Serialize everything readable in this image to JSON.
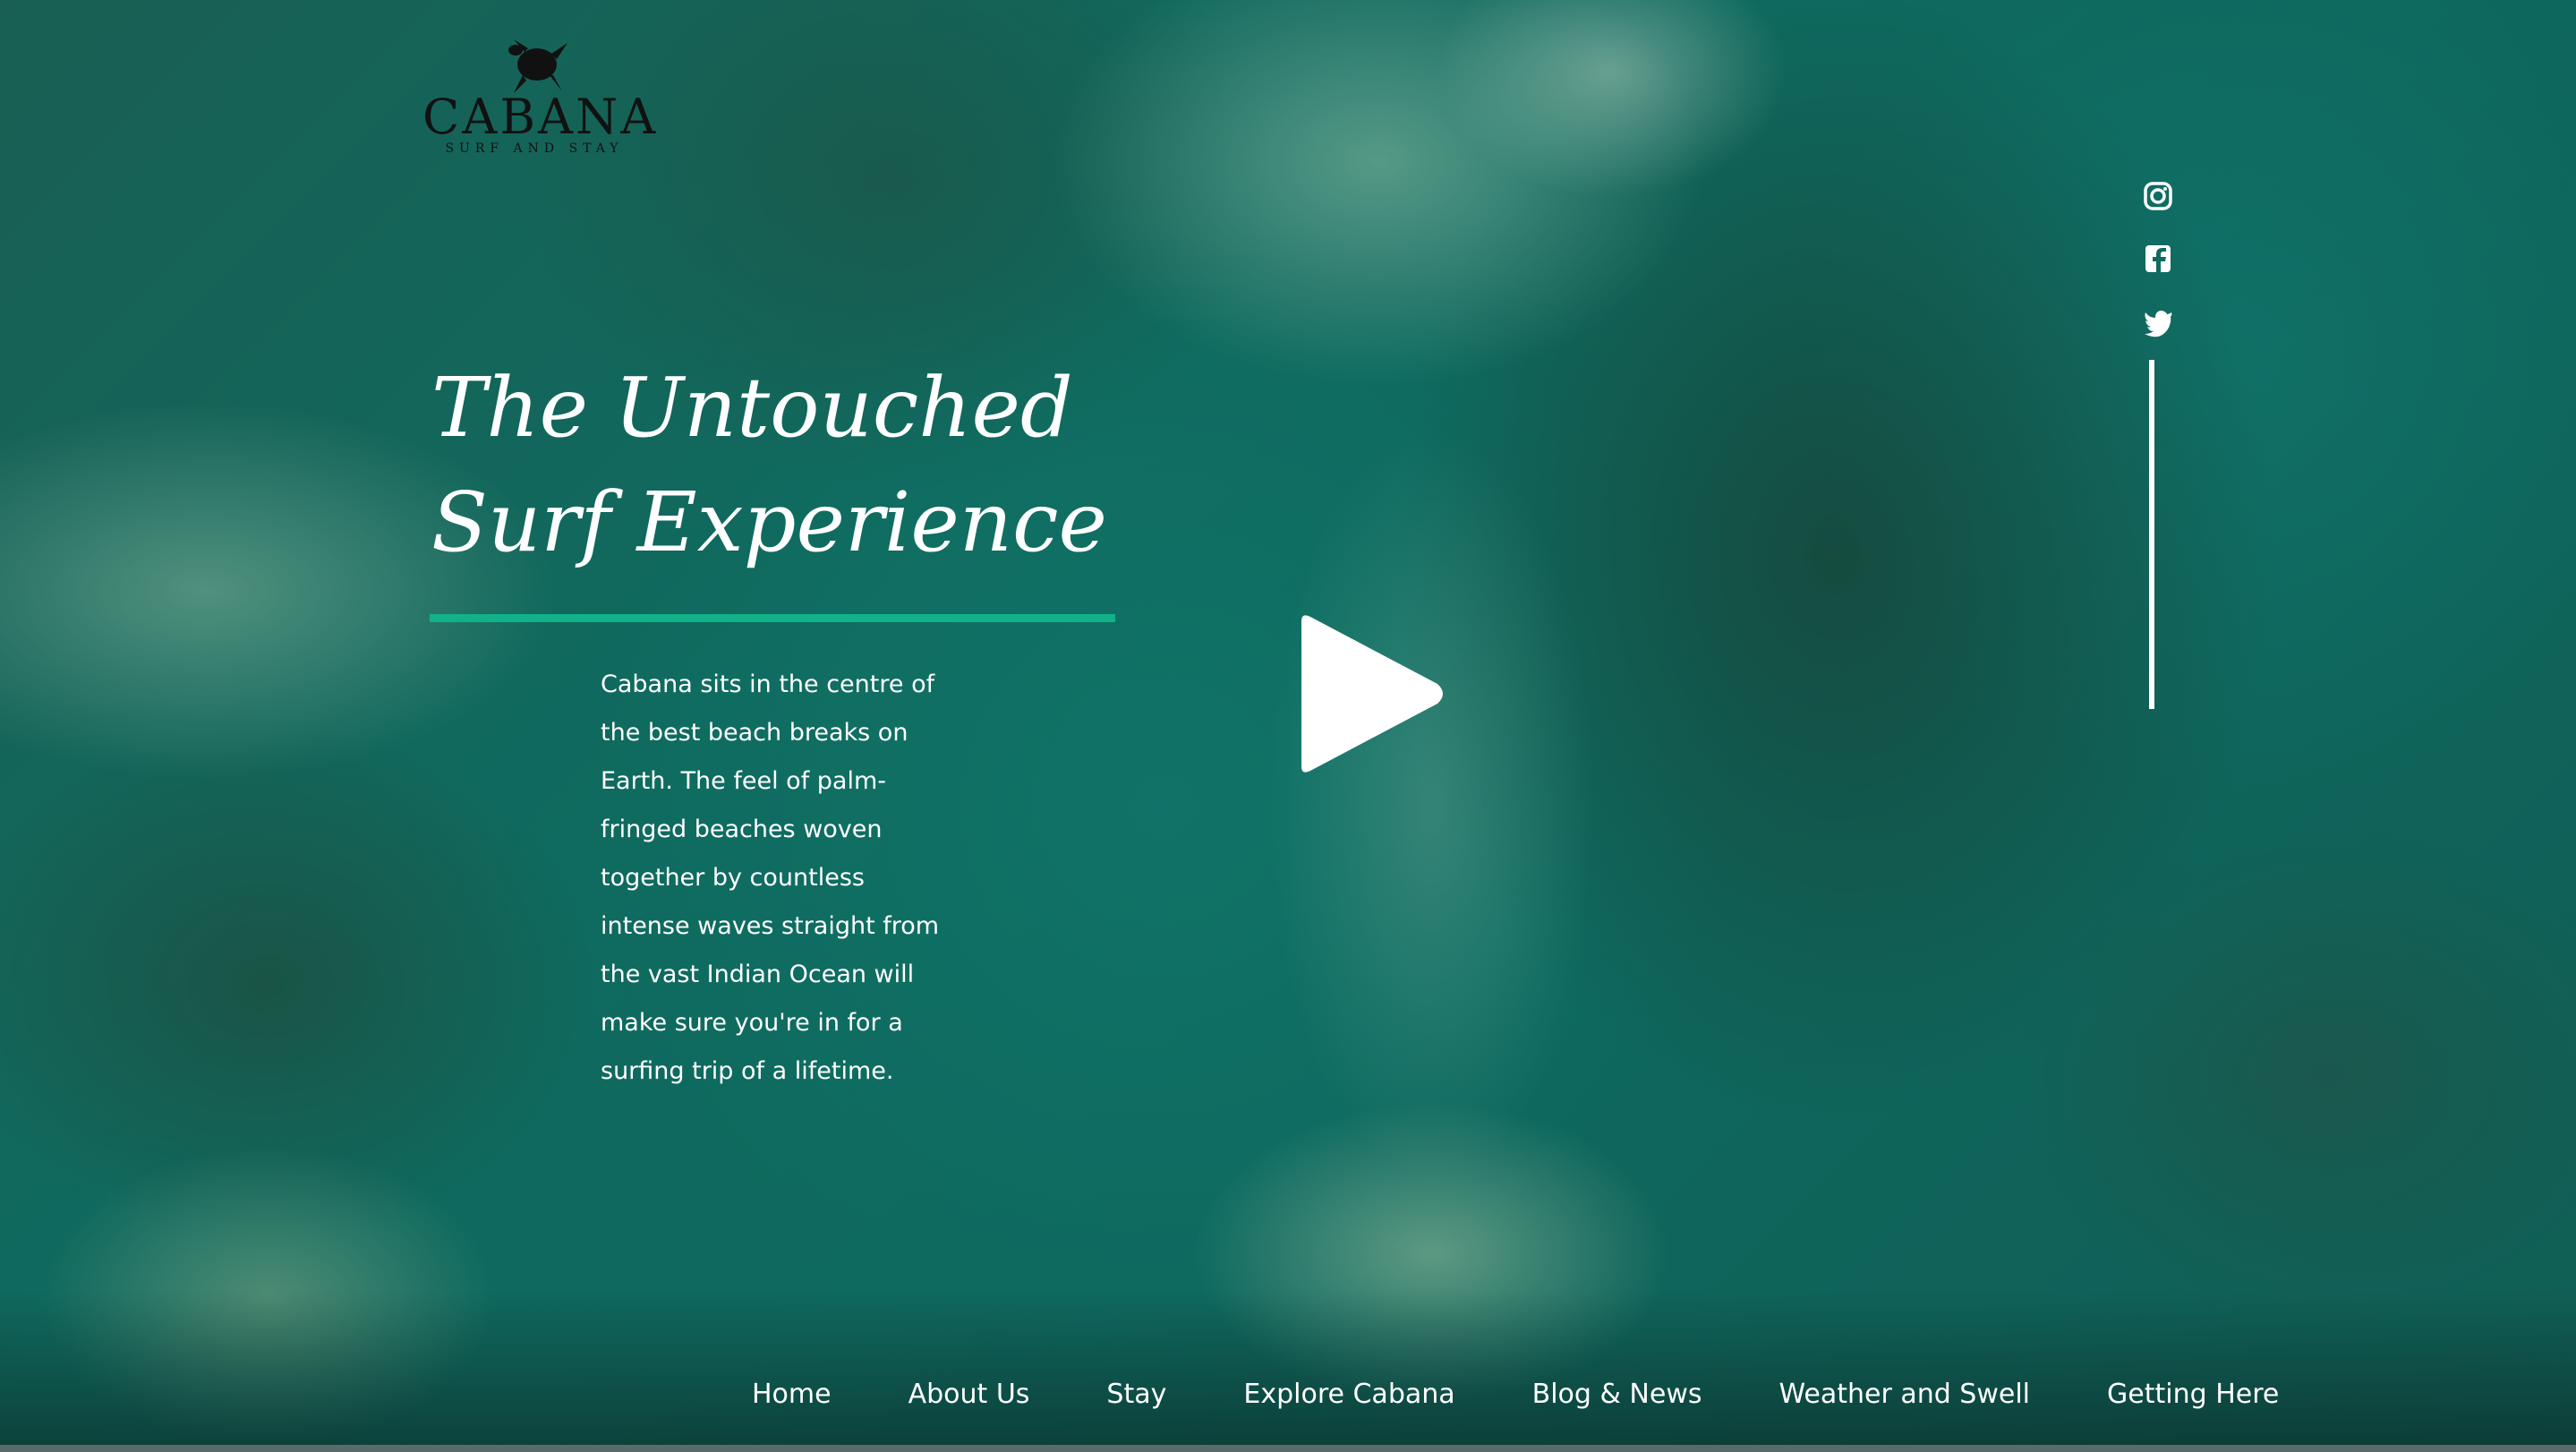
{
  "brand": {
    "name": "CABANA",
    "tagline": "SURF AND STAY"
  },
  "hero": {
    "title_line1": "The Untouched",
    "title_line2": "Surf Experience",
    "body": "Cabana sits in the centre of the best beach breaks on Earth. The feel of palm-fringed beaches woven together by countless intense waves straight from the vast Indian Ocean will make sure you're in for a surfing trip of a lifetime."
  },
  "video": {
    "play_icon": "play-icon"
  },
  "social": [
    {
      "name": "instagram",
      "icon": "instagram-icon"
    },
    {
      "name": "facebook",
      "icon": "facebook-icon"
    },
    {
      "name": "twitter",
      "icon": "twitter-icon"
    }
  ],
  "nav": {
    "items": [
      {
        "label": "Home"
      },
      {
        "label": "About Us"
      },
      {
        "label": "Stay"
      },
      {
        "label": "Explore Cabana"
      },
      {
        "label": "Blog & News"
      },
      {
        "label": "Weather and Swell"
      },
      {
        "label": "Getting Here"
      }
    ]
  },
  "colors": {
    "accent": "#11b28a",
    "text": "#ffffff",
    "logo": "#111111"
  }
}
